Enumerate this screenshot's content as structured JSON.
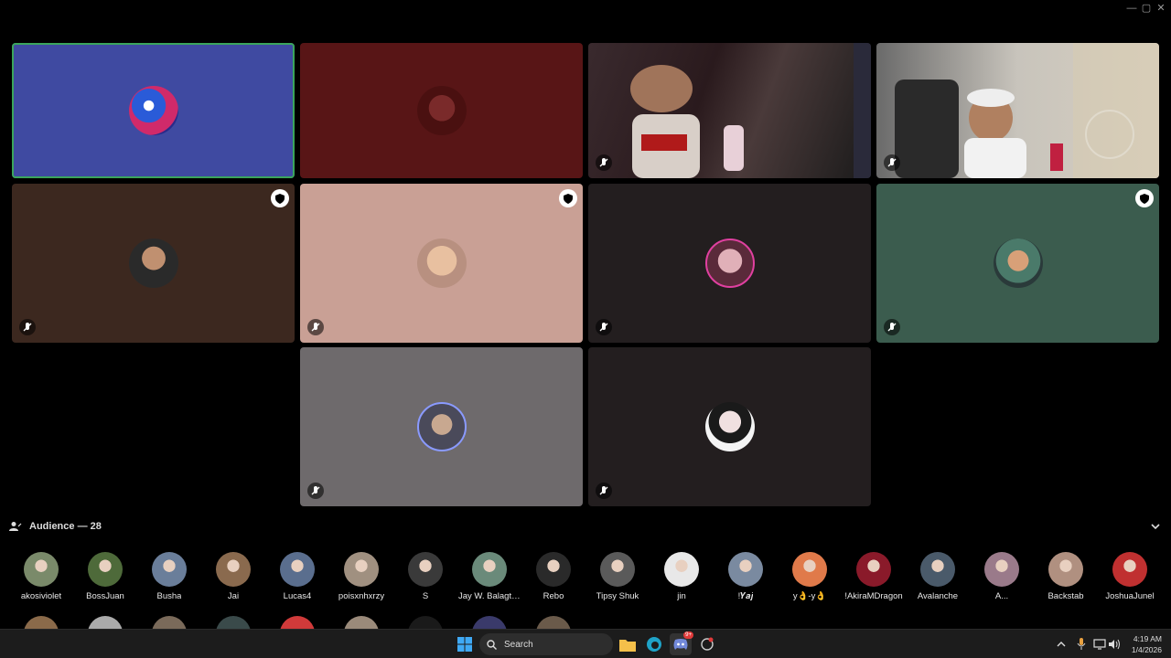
{
  "window": {
    "minimize": "—",
    "restore": "▢",
    "close": "✕"
  },
  "colors": {
    "tile_blue": "#3f4aa1",
    "tile_maroon": "#581516",
    "tile_brown": "#3c281f",
    "tile_pink": "#c9a095",
    "tile_dark": "#231e1f",
    "tile_green": "#3b5c4e",
    "tile_gray": "#6e6a6c",
    "speaking_ring": "#3ba55c"
  },
  "stage": {
    "tiles": [
      {
        "id": "t1",
        "kind": "avatar-tile",
        "color": "#3f4aa1",
        "speaking": true,
        "muted": false,
        "moderator": false
      },
      {
        "id": "t2",
        "kind": "avatar-tile",
        "color": "#581516",
        "speaking": false,
        "muted": false,
        "moderator": false
      },
      {
        "id": "t3",
        "kind": "video-tile",
        "color": "#2a1a1d",
        "speaking": false,
        "muted": true,
        "moderator": false
      },
      {
        "id": "t4",
        "kind": "video-tile",
        "color": "#7a7168",
        "speaking": false,
        "muted": true,
        "moderator": false
      },
      {
        "id": "t5",
        "kind": "avatar-tile",
        "color": "#3c281f",
        "speaking": false,
        "muted": true,
        "moderator": true
      },
      {
        "id": "t6",
        "kind": "avatar-tile",
        "color": "#c9a095",
        "speaking": false,
        "muted": true,
        "moderator": true
      },
      {
        "id": "t7",
        "kind": "avatar-tile",
        "color": "#231e1f",
        "speaking": false,
        "muted": true,
        "moderator": false
      },
      {
        "id": "t8",
        "kind": "avatar-tile",
        "color": "#3b5c4e",
        "speaking": false,
        "muted": true,
        "moderator": true
      },
      {
        "id": "t9",
        "kind": "avatar-tile",
        "color": "#6e6a6c",
        "speaking": false,
        "muted": true,
        "moderator": false
      },
      {
        "id": "t10",
        "kind": "avatar-tile",
        "color": "#231e1f",
        "speaking": false,
        "muted": true,
        "moderator": false
      }
    ]
  },
  "audience": {
    "title": "Audience — 28",
    "members": [
      {
        "name": "akosiviolet",
        "color": "#7a8a6a"
      },
      {
        "name": "BossJuan",
        "color": "#4e6a3a"
      },
      {
        "name": "Busha",
        "color": "#6a7e9a"
      },
      {
        "name": "Jai",
        "color": "#8a6a4e"
      },
      {
        "name": "Lucas4",
        "color": "#5a6e8e"
      },
      {
        "name": "poisxnhxrzy",
        "color": "#a09080"
      },
      {
        "name": "S",
        "color": "#3a3a3a"
      },
      {
        "name": "Jay W. Balagtas",
        "color": "#6a8a7a"
      },
      {
        "name": "Rebo",
        "color": "#2a2a2a"
      },
      {
        "name": "Tipsy Shuk",
        "color": "#5a5a5a"
      },
      {
        "name": "jin",
        "color": "#e8e8e8"
      },
      {
        "name": "!𝒀𝒂𝒋",
        "color": "#7a8aa0"
      },
      {
        "name": "y👌-y👌",
        "color": "#e07a4a"
      },
      {
        "name": "!AkiraMDragon",
        "color": "#8a1a2a"
      },
      {
        "name": "Avalanche",
        "color": "#4a5a6a"
      },
      {
        "name": "A...",
        "color": "#9a7a8a"
      },
      {
        "name": "Backstab",
        "color": "#b09080"
      },
      {
        "name": "JoshuaJunel",
        "color": "#c03030"
      }
    ],
    "row2_colors": [
      "#8a6a4a",
      "#aaaaaa",
      "#7a6a5a",
      "#3a4a4a",
      "#d03a3a",
      "#9a8a7a",
      "#1a1a1a",
      "#3a3a6a",
      "#6a5a4a"
    ]
  },
  "taskbar": {
    "search_label": "Search",
    "time": "4:19 AM",
    "date": "1/4/2026",
    "discord_badge": "9+"
  }
}
